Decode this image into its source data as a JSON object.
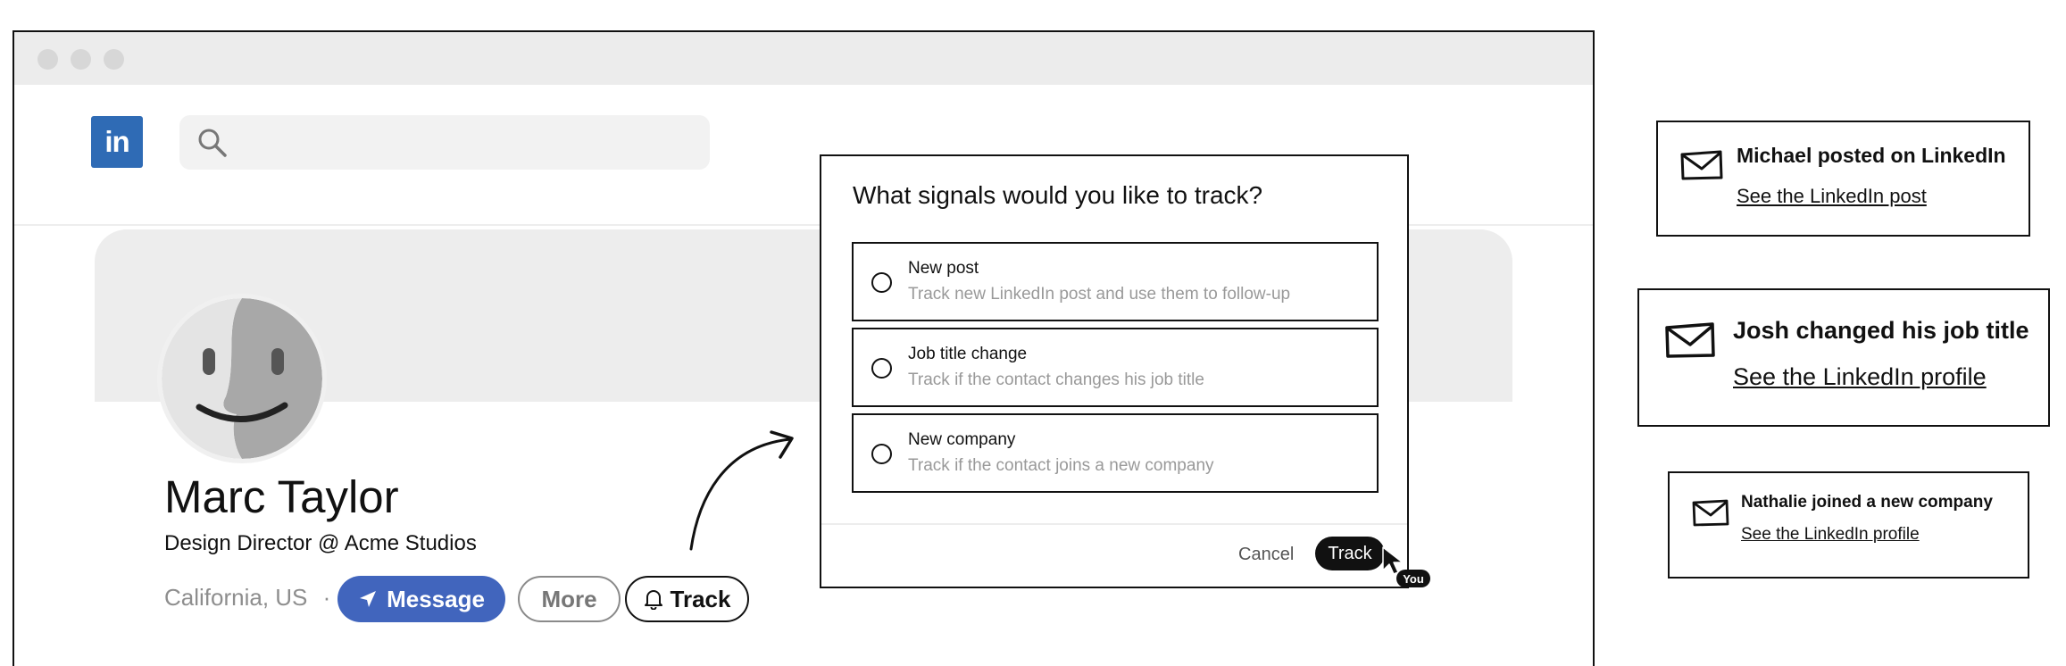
{
  "browser": {
    "logo_text": "in",
    "search": {
      "placeholder": ""
    }
  },
  "profile": {
    "name": "Marc Taylor",
    "role": "Design Director @ Acme Studios",
    "location": "California, US",
    "separator": "·",
    "buttons": {
      "message": "Message",
      "more": "More",
      "track": "Track"
    }
  },
  "modal": {
    "title": "What signals would you like to track?",
    "options": [
      {
        "label": "New post",
        "description": "Track new LinkedIn post and use them to follow-up"
      },
      {
        "label": "Job title change",
        "description": "Track if the contact changes his job title"
      },
      {
        "label": "New company",
        "description": "Track if the contact joins a new company"
      }
    ],
    "cancel_label": "Cancel",
    "confirm_label": "Track",
    "cursor_badge": "You"
  },
  "notifications": [
    {
      "title": "Michael posted on LinkedIn",
      "link": "See the LinkedIn post",
      "icon": "envelope-icon"
    },
    {
      "title": "Josh changed his job title",
      "link": "See the LinkedIn profile",
      "icon": "envelope-icon"
    },
    {
      "title": "Nathalie joined a new company",
      "link": "See the LinkedIn profile",
      "icon": "envelope-icon"
    }
  ],
  "colors": {
    "linkedin": "#2f6bb5",
    "message_button": "#4165bd",
    "dark": "#111111"
  }
}
